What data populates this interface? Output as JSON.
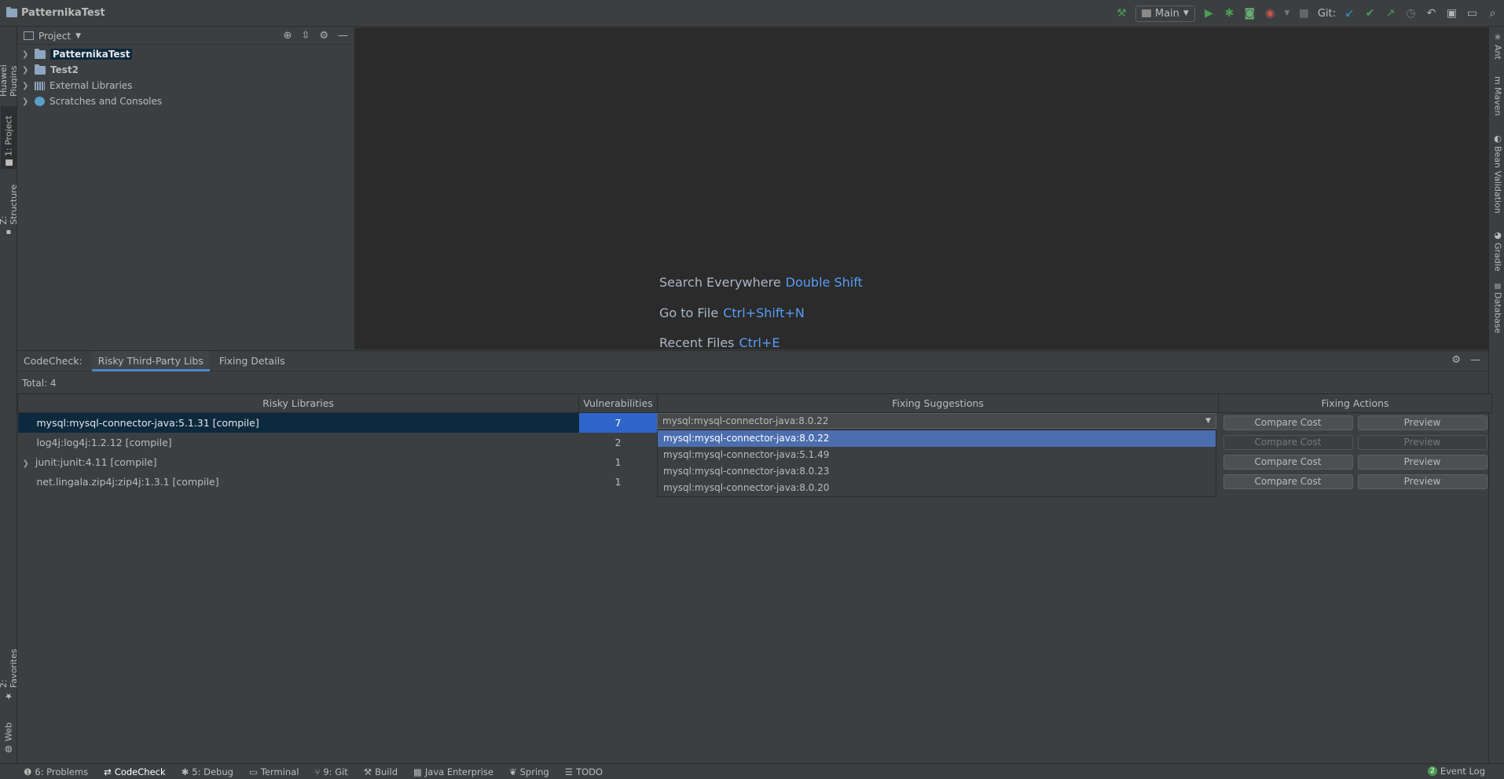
{
  "window": {
    "project_name": "PatternikaTest"
  },
  "toolbar": {
    "run_config": "Main",
    "git_label": "Git:",
    "colors": {
      "build": "#499c54",
      "run": "#499c54",
      "debug": "#499c54",
      "git_update": "#3592c4",
      "git_commit": "#499c54",
      "git_push": "#499c54"
    }
  },
  "left_stripe": {
    "tabs": [
      "Huawei Plugins",
      "1: Project",
      "Z: Structure",
      "2: Favorites",
      "Web"
    ]
  },
  "right_stripe": {
    "tabs": [
      "Ant",
      "Maven",
      "Bean Validation",
      "Gradle",
      "Database"
    ]
  },
  "project_panel": {
    "title": "Project",
    "items": [
      {
        "label": "PatternikaTest",
        "icon": "folder-icon"
      },
      {
        "label": "Test2",
        "icon": "folder-icon"
      },
      {
        "label": "External Libraries",
        "icon": "library-icon"
      },
      {
        "label": "Scratches and Consoles",
        "icon": "scratches-icon"
      }
    ]
  },
  "editor": {
    "hints": [
      {
        "text": "Search Everywhere",
        "key": "Double Shift"
      },
      {
        "text": "Go to File",
        "key": "Ctrl+Shift+N"
      },
      {
        "text": "Recent Files",
        "key": "Ctrl+E"
      }
    ]
  },
  "codecheck": {
    "label": "CodeCheck:",
    "tabs": [
      "Risky Third-Party Libs",
      "Fixing Details"
    ],
    "total": "Total: 4",
    "columns": [
      "Risky Libraries",
      "Vulnerabilities",
      "Fixing Suggestions",
      "Fixing Actions"
    ],
    "rows": [
      {
        "library": "mysql:mysql-connector-java:5.1.31 [compile]",
        "vulns": "7",
        "compare": "Compare Cost",
        "preview": "Preview"
      },
      {
        "library": "log4j:log4j:1.2.12 [compile]",
        "vulns": "2",
        "compare": "Compare Cost",
        "preview": "Preview"
      },
      {
        "library": "junit:junit:4.11 [compile]",
        "vulns": "1",
        "compare": "Compare Cost",
        "preview": "Preview"
      },
      {
        "library": "net.lingala.zip4j:zip4j:1.3.1 [compile]",
        "vulns": "1",
        "compare": "Compare Cost",
        "preview": "Preview"
      }
    ],
    "suggestion_selected": "mysql:mysql-connector-java:8.0.22",
    "suggestion_options": [
      "mysql:mysql-connector-java:8.0.22",
      "mysql:mysql-connector-java:5.1.49",
      "mysql:mysql-connector-java:8.0.23",
      "mysql:mysql-connector-java:8.0.20"
    ]
  },
  "statusbar": {
    "items": [
      "6: Problems",
      "CodeCheck",
      "5: Debug",
      "Terminal",
      "9: Git",
      "Build",
      "Java Enterprise",
      "Spring",
      "TODO"
    ],
    "event_log": "Event Log",
    "event_count": "2"
  }
}
